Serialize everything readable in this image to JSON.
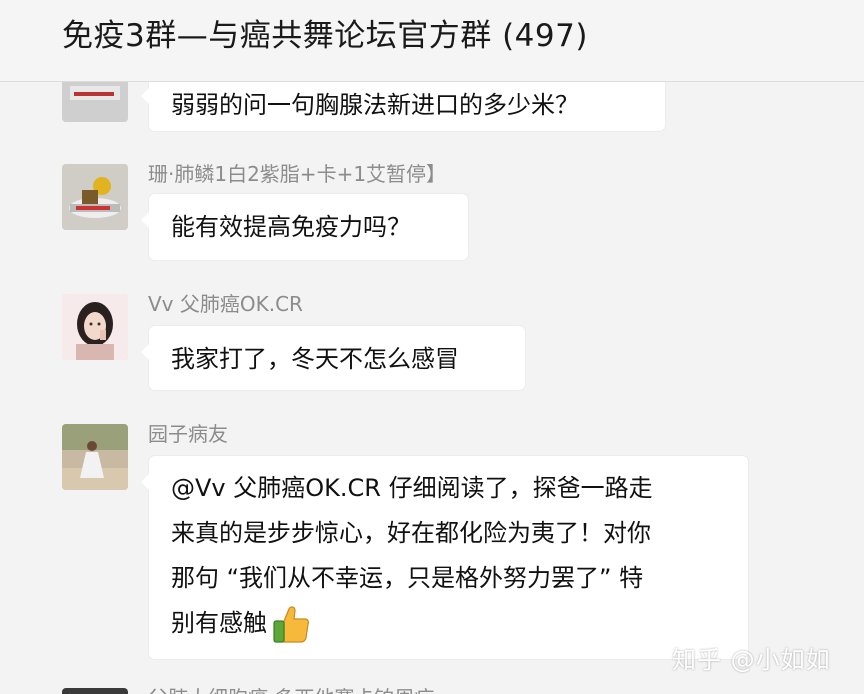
{
  "header": {
    "title": "免疫3群—与癌共舞论坛官方群 (497)"
  },
  "messages": [
    {
      "sender": "",
      "text": "弱弱的问一句胸腺法新进口的多少米？"
    },
    {
      "sender": "珊·肺鳞1白2紫脂+卡+1艾暂停】",
      "text": "能有效提高免疫力吗？"
    },
    {
      "sender": "Vv 父肺癌OK.CR",
      "text": "我家打了，冬天不怎么感冒"
    },
    {
      "sender": "园子病友",
      "lines": [
        "@Vv 父肺癌OK.CR 仔细阅读了，探爸一路走",
        "来真的是步步惊心，好在都化险为夷了！对你",
        "那句 “我们从不幸运，只是格外努力罢了” 特",
        "别有感触"
      ]
    },
    {
      "sender": "父肺大细胞癌 多西他赛卡铂周疗"
    }
  ],
  "watermark": "知乎 @小如如",
  "icons": {
    "thumb": "thumbs-up-icon"
  }
}
